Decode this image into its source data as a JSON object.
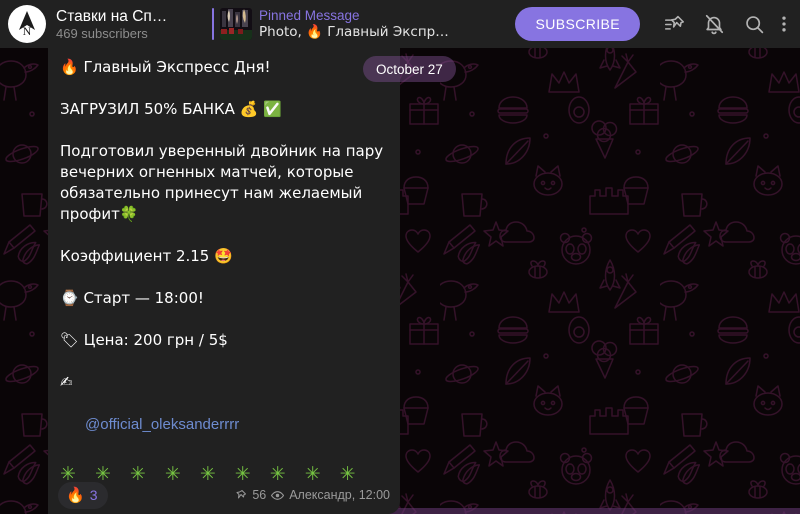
{
  "header": {
    "avatar_icon": "compass-north-logo",
    "channel_title": "Ставки на Сп…",
    "subscribers": "469 subscribers",
    "pinned": {
      "label": "Pinned Message",
      "preview": "Photo, 🔥 Главный Экспресс …",
      "thumbnail_icon": "stadium-flares-photo"
    },
    "subscribe_label": "SUBSCRIBE",
    "icons": {
      "pinned_list": "pinned-messages-icon",
      "notifications": "bell-muted-icon",
      "search": "search-icon",
      "menu": "more-vertical-icon"
    },
    "colors": {
      "accent": "#8774e1",
      "header_bg": "#212121",
      "title_text": "#ffffff",
      "subtitle_text": "#8d8d8d"
    }
  },
  "chat": {
    "date_separator": "October 27",
    "background": {
      "base_color": "#0a0507",
      "doodle_color": "#2d1426"
    }
  },
  "message": {
    "body": "🔥 Главный Экспресс Дня!\n\nЗАГРУЗИЛ 50% БАНКА 💰 ✅\n\nПодготовил уверенный двойник на пару вечерних огненных матчей, которые обязательно принесут нам желаемый профит🍀\n\nКоэффициент 2.15 🤩\n\n⌚ Старт — 18:00!\n\n🏷 Цена: 200 грн / 5$\n\n✍",
    "mention": "@official_oleksanderrrr",
    "sparkles": "✳ ✳ ✳ ✳ ✳ ✳ ✳ ✳ ✳ ✳",
    "sparkle_count": 10,
    "sparkle_color": "#76c442",
    "reaction": {
      "emoji": "🔥",
      "count": "3"
    },
    "meta": {
      "pin_icon": "pin-icon",
      "views": "56",
      "views_icon": "eye-icon",
      "signature": "Александр, 12:00"
    },
    "bubble_color": "#212121",
    "link_color": "#6e8cd0"
  }
}
